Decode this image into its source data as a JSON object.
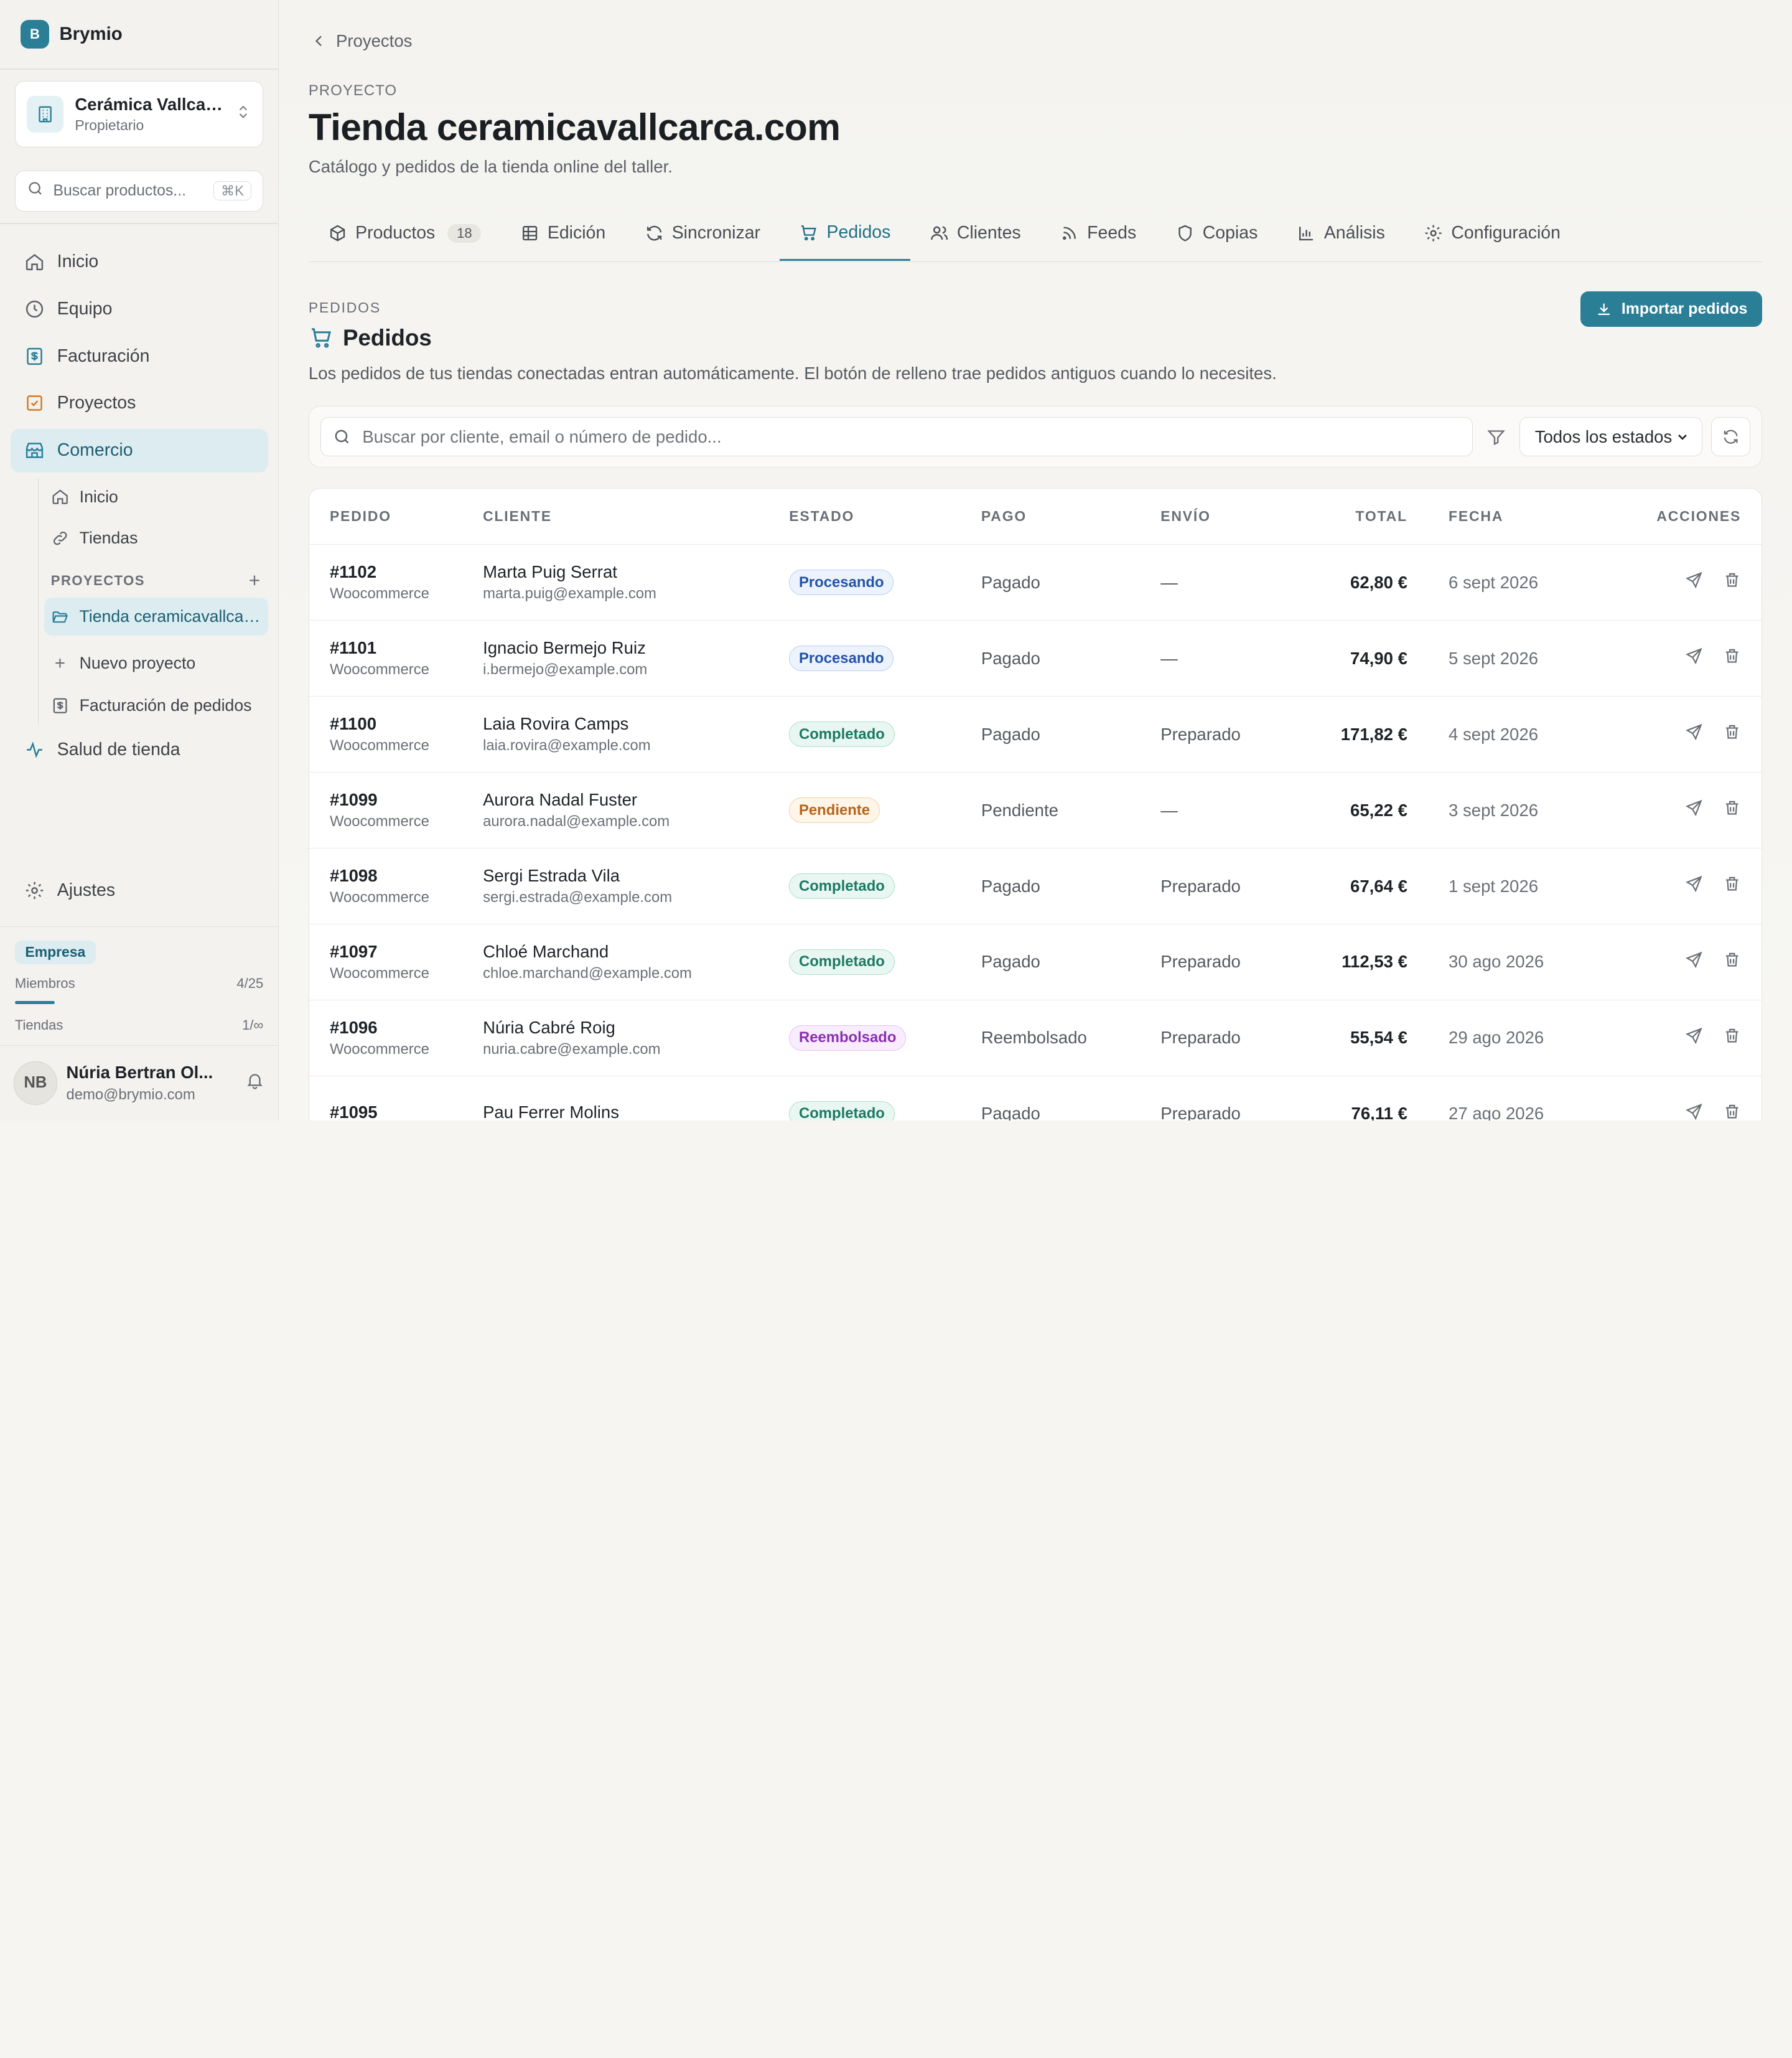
{
  "brand": {
    "initial": "B",
    "name": "Brymio"
  },
  "org": {
    "name": "Cerámica Vallcar...",
    "role": "Propietario"
  },
  "side_search": {
    "placeholder": "Buscar productos...",
    "shortcut": "⌘K"
  },
  "nav": {
    "inicio": "Inicio",
    "equipo": "Equipo",
    "facturacion": "Facturación",
    "proyectos": "Proyectos",
    "comercio": "Comercio",
    "sub_inicio": "Inicio",
    "sub_tiendas": "Tiendas",
    "proyectos_head": "PROYECTOS",
    "tienda": "Tienda ceramicavallcar...",
    "nuevo": "Nuevo proyecto",
    "fact_pedidos": "Facturación de pedidos",
    "salud": "Salud de tienda",
    "ajustes": "Ajustes"
  },
  "plan": {
    "badge": "Empresa",
    "miembros_label": "Miembros",
    "miembros_value": "4/25",
    "miembros_fraction": 0.16,
    "tiendas_label": "Tiendas",
    "tiendas_value": "1/∞"
  },
  "user": {
    "initials": "NB",
    "name": "Núria Bertran Ol...",
    "email": "demo@brymio.com"
  },
  "header": {
    "back": "Proyectos",
    "eyebrow": "PROYECTO",
    "title": "Tienda ceramicavallcarca.com",
    "subtitle": "Catálogo y pedidos de la tienda online del taller."
  },
  "tabs": [
    {
      "label": "Productos",
      "count": "18"
    },
    {
      "label": "Edición"
    },
    {
      "label": "Sincronizar"
    },
    {
      "label": "Pedidos"
    },
    {
      "label": "Clientes"
    },
    {
      "label": "Feeds"
    },
    {
      "label": "Copias"
    },
    {
      "label": "Análisis"
    },
    {
      "label": "Configuración"
    }
  ],
  "section": {
    "eyebrow": "PEDIDOS",
    "title": "Pedidos",
    "description": "Los pedidos de tus tiendas conectadas entran automáticamente. El botón de relleno trae pedidos antiguos cuando lo necesites.",
    "import_label": "Importar pedidos"
  },
  "filters": {
    "search_placeholder": "Buscar por cliente, email o número de pedido...",
    "status_selected": "Todos los estados"
  },
  "table": {
    "headers": [
      "PEDIDO",
      "CLIENTE",
      "ESTADO",
      "PAGO",
      "ENVÍO",
      "TOTAL",
      "FECHA",
      "ACCIONES"
    ],
    "rows": [
      {
        "id": "#1102",
        "source": "Woocommerce",
        "customer": "Marta Puig Serrat",
        "email": "marta.puig@example.com",
        "status": "Procesando",
        "status_kind": "procesando",
        "payment": "Pagado",
        "shipping": "—",
        "total": "62,80 €",
        "date": "6 sept 2026"
      },
      {
        "id": "#1101",
        "source": "Woocommerce",
        "customer": "Ignacio Bermejo Ruiz",
        "email": "i.bermejo@example.com",
        "status": "Procesando",
        "status_kind": "procesando",
        "payment": "Pagado",
        "shipping": "—",
        "total": "74,90 €",
        "date": "5 sept 2026"
      },
      {
        "id": "#1100",
        "source": "Woocommerce",
        "customer": "Laia Rovira Camps",
        "email": "laia.rovira@example.com",
        "status": "Completado",
        "status_kind": "completado",
        "payment": "Pagado",
        "shipping": "Preparado",
        "total": "171,82 €",
        "date": "4 sept 2026"
      },
      {
        "id": "#1099",
        "source": "Woocommerce",
        "customer": "Aurora Nadal Fuster",
        "email": "aurora.nadal@example.com",
        "status": "Pendiente",
        "status_kind": "pendiente",
        "payment": "Pendiente",
        "shipping": "—",
        "total": "65,22 €",
        "date": "3 sept 2026"
      },
      {
        "id": "#1098",
        "source": "Woocommerce",
        "customer": "Sergi Estrada Vila",
        "email": "sergi.estrada@example.com",
        "status": "Completado",
        "status_kind": "completado",
        "payment": "Pagado",
        "shipping": "Preparado",
        "total": "67,64 €",
        "date": "1 sept 2026"
      },
      {
        "id": "#1097",
        "source": "Woocommerce",
        "customer": "Chloé Marchand",
        "email": "chloe.marchand@example.com",
        "status": "Completado",
        "status_kind": "completado",
        "payment": "Pagado",
        "shipping": "Preparado",
        "total": "112,53 €",
        "date": "30 ago 2026"
      },
      {
        "id": "#1096",
        "source": "Woocommerce",
        "customer": "Núria Cabré Roig",
        "email": "nuria.cabre@example.com",
        "status": "Reembolsado",
        "status_kind": "reembolsado",
        "payment": "Reembolsado",
        "shipping": "Preparado",
        "total": "55,54 €",
        "date": "29 ago 2026"
      },
      {
        "id": "#1095",
        "source": "",
        "customer": "Pau Ferrer Molins",
        "email": "",
        "status": "Completado",
        "status_kind": "completado",
        "payment": "Pagado",
        "shipping": "Preparado",
        "total": "76,11 €",
        "date": "27 ago 2026"
      }
    ]
  },
  "colors": {
    "accent": "#2a7f97",
    "sidebar_bg": "#f3f2ef",
    "active_bg": "#dcecf0"
  }
}
